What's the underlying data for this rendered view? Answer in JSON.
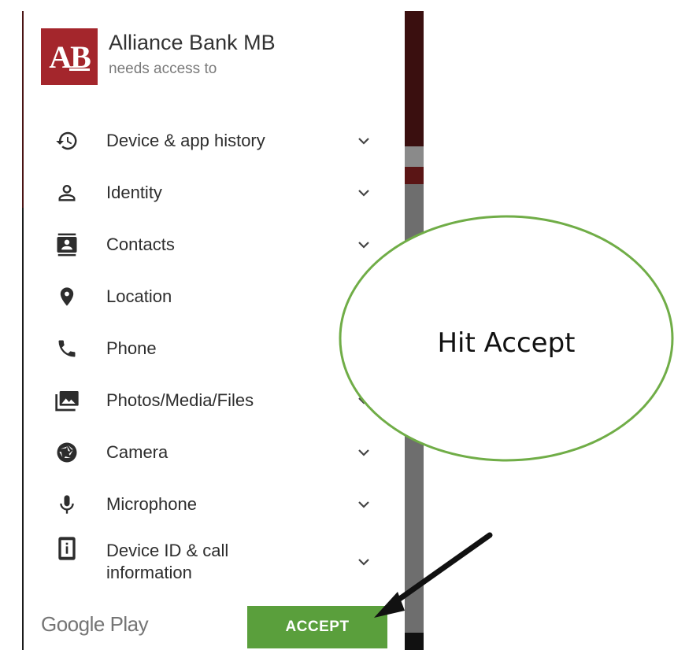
{
  "app": {
    "logo_text": "AB",
    "name": "Alliance Bank MB",
    "subtitle": "needs access to",
    "brand_color": "#a4262c"
  },
  "permissions": [
    {
      "label": "Device & app history",
      "icon": "history-icon",
      "expandable": true
    },
    {
      "label": "Identity",
      "icon": "person-icon",
      "expandable": true
    },
    {
      "label": "Contacts",
      "icon": "contacts-icon",
      "expandable": true
    },
    {
      "label": "Location",
      "icon": "location-pin-icon",
      "expandable": false
    },
    {
      "label": "Phone",
      "icon": "phone-icon",
      "expandable": false
    },
    {
      "label": "Photos/Media/Files",
      "icon": "photos-icon",
      "expandable": true
    },
    {
      "label": "Camera",
      "icon": "camera-shutter-icon",
      "expandable": true
    },
    {
      "label": "Microphone",
      "icon": "microphone-icon",
      "expandable": true
    },
    {
      "label": "Device ID & call information",
      "icon": "device-info-icon",
      "expandable": true
    }
  ],
  "footer": {
    "brand": "Google Play",
    "accept_label": "ACCEPT",
    "accept_color": "#5a9f3c"
  },
  "annotation": {
    "text": "Hit Accept",
    "circle_color": "#70ad47",
    "arrow_color": "#111111"
  }
}
